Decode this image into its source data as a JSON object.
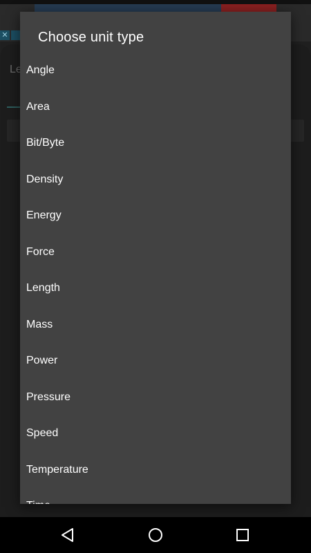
{
  "dialog": {
    "title": "Choose unit type",
    "items": [
      {
        "label": "Angle"
      },
      {
        "label": "Area"
      },
      {
        "label": "Bit/Byte"
      },
      {
        "label": "Density"
      },
      {
        "label": "Energy"
      },
      {
        "label": "Force"
      },
      {
        "label": "Length"
      },
      {
        "label": "Mass"
      },
      {
        "label": "Power"
      },
      {
        "label": "Pressure"
      },
      {
        "label": "Speed"
      },
      {
        "label": "Temperature"
      },
      {
        "label": "Time"
      }
    ]
  },
  "background": {
    "label_fragment": "Le"
  },
  "navbar": {
    "back_icon": "back-triangle-icon",
    "home_icon": "home-circle-icon",
    "recents_icon": "recents-square-icon"
  },
  "colors": {
    "dialog_bg": "#424242",
    "text": "#ffffff",
    "accent": "#2e5f5f"
  }
}
